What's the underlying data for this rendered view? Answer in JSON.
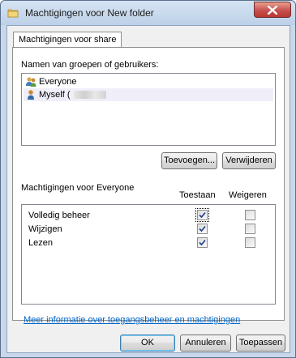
{
  "window": {
    "title": "Machtigingen voor New folder"
  },
  "tab": {
    "label": "Machtigingen voor share"
  },
  "users": {
    "label": "Namen van groepen of gebruikers:",
    "items": [
      {
        "name": "Everyone",
        "selected": false,
        "icon": "group-users-icon"
      },
      {
        "name": "Myself (",
        "selected": true,
        "icon": "user-icon"
      }
    ],
    "add_button": "Toevoegen...",
    "remove_button": "Verwijderen"
  },
  "permissions": {
    "title": "Machtigingen voor Everyone",
    "allow_header": "Toestaan",
    "deny_header": "Weigeren",
    "rows": [
      {
        "name": "Volledig beheer",
        "allow": true,
        "deny": false
      },
      {
        "name": "Wijzigen",
        "allow": true,
        "deny": false
      },
      {
        "name": "Lezen",
        "allow": true,
        "deny": false
      }
    ]
  },
  "link_text": "Meer informatie over toegangsbeheer en machtigingen",
  "footer": {
    "ok": "OK",
    "cancel": "Annuleren",
    "apply": "Toepassen"
  },
  "colors": {
    "link": "#0066cc",
    "close_button": "#c75050",
    "selection": "#f0eef8"
  }
}
